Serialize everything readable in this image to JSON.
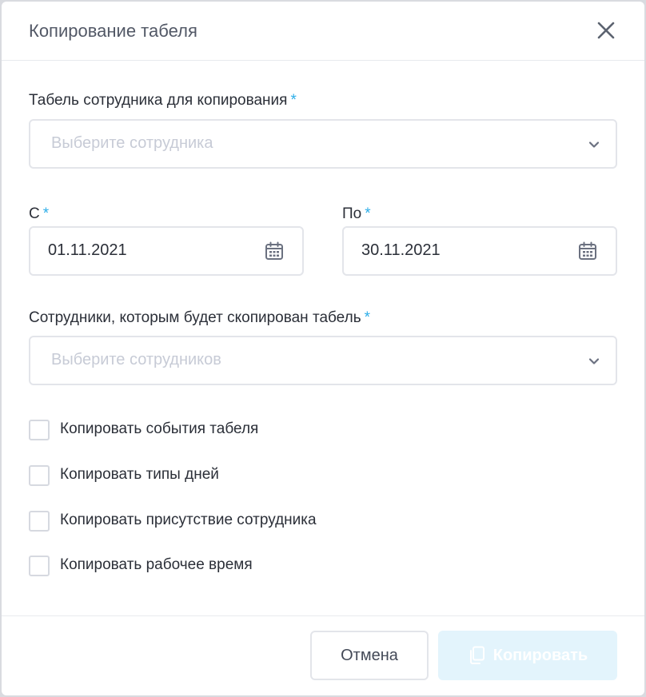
{
  "dialog": {
    "title": "Копирование табеля"
  },
  "source_employee": {
    "label": "Табель сотрудника для копирования",
    "required_mark": "*",
    "placeholder": "Выберите сотрудника"
  },
  "date_from": {
    "label": "С",
    "required_mark": "*",
    "value": "01.11.2021"
  },
  "date_to": {
    "label": "По",
    "required_mark": "*",
    "value": "30.11.2021"
  },
  "target_employees": {
    "label": "Сотрудники, которым будет скопирован табель",
    "required_mark": "*",
    "placeholder": "Выберите сотрудников"
  },
  "options": [
    {
      "label": "Копировать события табеля",
      "checked": false
    },
    {
      "label": "Копировать типы дней",
      "checked": false
    },
    {
      "label": "Копировать присутствие сотрудника",
      "checked": false
    },
    {
      "label": "Копировать рабочее время",
      "checked": false
    }
  ],
  "footer": {
    "cancel_label": "Отмена",
    "copy_label": "Копировать"
  },
  "colors": {
    "accent": "#2eaee8",
    "copy_button_disabled_bg": "#e3f4fc",
    "placeholder": "#c7cbd6",
    "text": "#2b2f38"
  },
  "icons": {
    "close": "close-icon",
    "select_chevron": "chevron-down-icon",
    "date_picker": "calendar-icon",
    "copy": "copy-icon"
  }
}
